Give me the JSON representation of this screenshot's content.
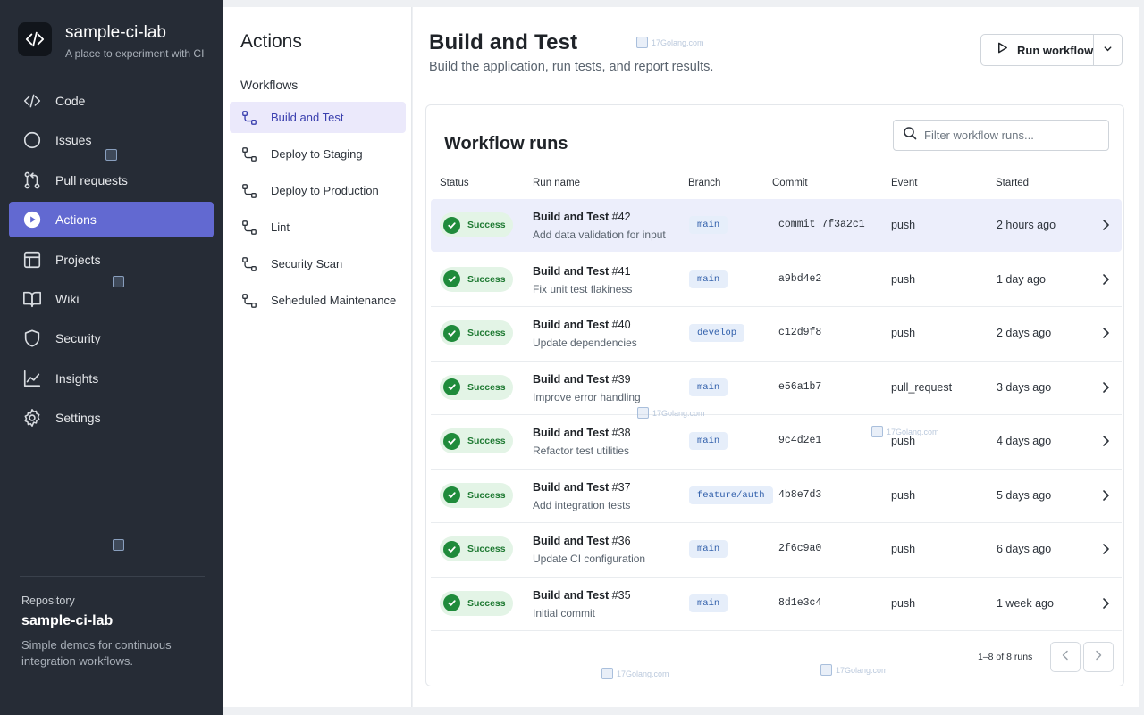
{
  "sidebar": {
    "repo_name": "sample-ci-lab",
    "repo_desc": "A place to experiment with CI",
    "items": [
      {
        "label": "Code",
        "icon": "code-icon"
      },
      {
        "label": "Issues",
        "icon": "issue-circle-icon"
      },
      {
        "label": "Pull requests",
        "icon": "pull-request-icon"
      },
      {
        "label": "Actions",
        "icon": "play-circle-icon",
        "active": true
      },
      {
        "label": "Projects",
        "icon": "project-table-icon"
      },
      {
        "label": "Wiki",
        "icon": "book-icon"
      },
      {
        "label": "Security",
        "icon": "shield-icon"
      },
      {
        "label": "Insights",
        "icon": "graph-icon"
      },
      {
        "label": "Settings",
        "icon": "gear-icon"
      }
    ],
    "footer": {
      "label": "Repository",
      "name": "sample-ci-lab",
      "description": "Simple demos for continuous integration workflows."
    }
  },
  "workflows": {
    "title": "Actions",
    "subtitle": "Workflows",
    "items": [
      {
        "label": "Build and Test",
        "active": true
      },
      {
        "label": "Deploy to Staging"
      },
      {
        "label": "Deploy to Production"
      },
      {
        "label": "Lint"
      },
      {
        "label": "Security Scan"
      },
      {
        "label": "Seheduled Maintenance"
      }
    ]
  },
  "main": {
    "title": "Build and Test",
    "subtitle": "Build the application, run tests, and report results.",
    "run_button": "Run workflow",
    "card_title": "Workflow runs",
    "filter_placeholder": "Filter workflow runs...",
    "columns": {
      "status": "Status",
      "run_name": "Run name",
      "branch": "Branch",
      "commit": "Commit",
      "event": "Event",
      "started": "Started"
    },
    "runs": [
      {
        "status": "Success",
        "name": "Build and Test",
        "num": "#42",
        "msg": "Add data validation for input",
        "branch": "main",
        "commit": "commit 7f3a2c1",
        "event": "push",
        "started": "2 hours ago"
      },
      {
        "status": "Success",
        "name": "Build and Test",
        "num": "#41",
        "msg": "Fix unit test flakiness",
        "branch": "main",
        "commit": "a9bd4e2",
        "event": "push",
        "started": "1 day ago"
      },
      {
        "status": "Success",
        "name": "Build and Test",
        "num": "#40",
        "msg": "Update dependencies",
        "branch": "develop",
        "commit": "c12d9f8",
        "event": "push",
        "started": "2 days ago"
      },
      {
        "status": "Success",
        "name": "Build and Test",
        "num": "#39",
        "msg": "Improve error handling",
        "branch": "main",
        "commit": "e56a1b7",
        "event": "pull_request",
        "started": "3 days ago"
      },
      {
        "status": "Success",
        "name": "Build and Test",
        "num": "#38",
        "msg": "Refactor test utilities",
        "branch": "main",
        "commit": "9c4d2e1",
        "event": "push",
        "started": "4 days ago"
      },
      {
        "status": "Success",
        "name": "Build and Test",
        "num": "#37",
        "msg": "Add integration tests",
        "branch": "feature/auth",
        "commit": "4b8e7d3",
        "event": "push",
        "started": "5 days ago"
      },
      {
        "status": "Success",
        "name": "Build and Test",
        "num": "#36",
        "msg": "Update CI configuration",
        "branch": "main",
        "commit": "2f6c9a0",
        "event": "push",
        "started": "6 days ago"
      },
      {
        "status": "Success",
        "name": "Build and Test",
        "num": "#35",
        "msg": "Initial commit",
        "branch": "main",
        "commit": "8d1e3c4",
        "event": "push",
        "started": "1 week ago"
      }
    ],
    "pagination": "1–8 of 8 runs"
  },
  "watermark": "17Golang.com",
  "colors": {
    "sidebar_bg": "#262c36",
    "accent": "#6269d1",
    "success": "#1f8b3b",
    "branch_text": "#2f5eaa"
  }
}
